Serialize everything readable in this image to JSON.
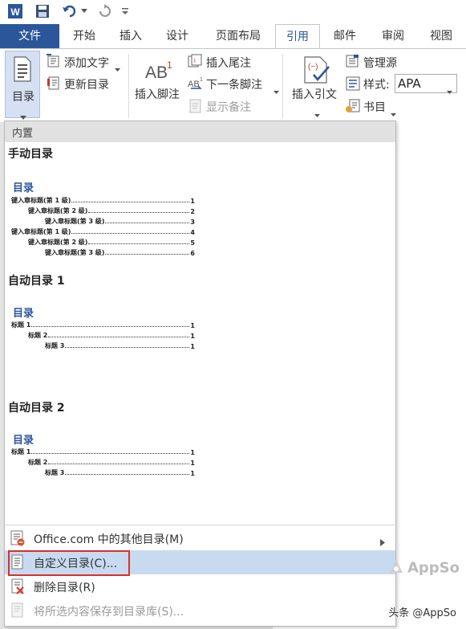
{
  "tabs": {
    "file": "文件",
    "home": "开始",
    "insert": "插入",
    "design": "设计",
    "layout": "页面布局",
    "references": "引用",
    "mailings": "邮件",
    "review": "审阅",
    "view": "视图"
  },
  "ribbon": {
    "toc": "目录",
    "add_text": "添加文字",
    "update_toc": "更新目录",
    "insert_footnote": "插入脚注",
    "insert_endnote": "插入尾注",
    "next_footnote": "下一条脚注",
    "show_notes": "显示备注",
    "insert_citation": "插入引文",
    "manage_sources": "管理源",
    "style_label": "样式:",
    "style_value": "APA",
    "bibliography": "书目",
    "group_suffix": "目",
    "footnote_ab": "AB"
  },
  "dropdown": {
    "header": "内置",
    "manual": {
      "title": "手动目录",
      "toc_title": "目录",
      "lines": [
        {
          "text": "键入章标题(第 1 级)",
          "page": "1"
        },
        {
          "text": "键入章标题(第 2 级)",
          "page": "2"
        },
        {
          "text": "键入章标题(第 3 级)",
          "page": "3"
        },
        {
          "text": "键入章标题(第 1 级)",
          "page": "4"
        },
        {
          "text": "键入章标题(第 2 级)",
          "page": "5"
        },
        {
          "text": "键入章标题(第 3 级)",
          "page": "6"
        }
      ]
    },
    "auto1": {
      "title": "自动目录 1",
      "toc_title": "目录",
      "lines": [
        {
          "text": "标题 1",
          "page": "1"
        },
        {
          "text": "标题 2",
          "page": "1"
        },
        {
          "text": "标题 3",
          "page": "1"
        }
      ]
    },
    "auto2": {
      "title": "自动目录 2",
      "toc_title": "目录",
      "lines": [
        {
          "text": "标题 1",
          "page": "1"
        },
        {
          "text": "标题 2",
          "page": "1"
        },
        {
          "text": "标题 3",
          "page": "1"
        }
      ]
    },
    "menu": {
      "more": "Office.com 中的其他目录(M)",
      "custom": "自定义目录(C)...",
      "remove": "删除目录(R)",
      "save": "将所选内容保存到目录库(S)..."
    }
  },
  "watermark": "AppSo",
  "footer_mark": "头条 @AppSo",
  "colors": {
    "accent": "#2b579a",
    "highlight": "#c7daf0",
    "callout": "#d9312a"
  }
}
